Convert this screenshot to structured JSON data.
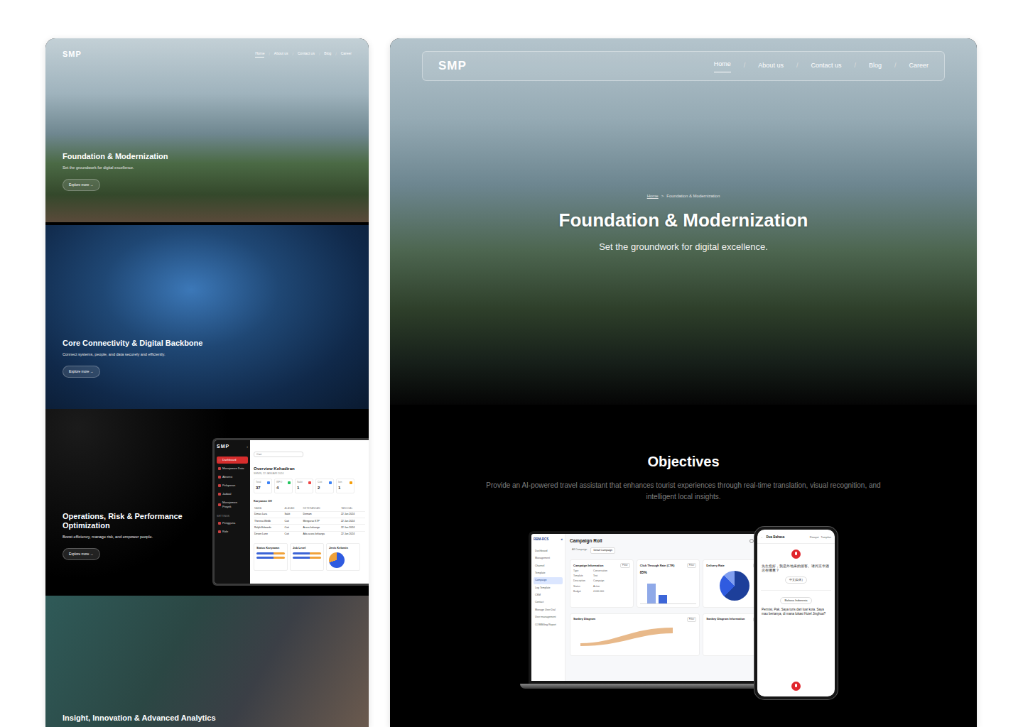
{
  "left_page": {
    "nav": {
      "logo": "SMP",
      "separator": "/",
      "items": [
        {
          "label": "Home",
          "selected": true
        },
        {
          "label": "About us",
          "selected": false
        },
        {
          "label": "Contact us",
          "selected": false
        },
        {
          "label": "Blog",
          "selected": false
        },
        {
          "label": "Career",
          "selected": false
        }
      ]
    },
    "sections": [
      {
        "kind": "photo-city",
        "title": "Foundation & Modernization",
        "subtitle": "Set the groundwork for digital excellence.",
        "cta": "Explore more →"
      },
      {
        "kind": "photo-network",
        "title": "Core Connectivity & Digital Backbone",
        "subtitle": "Connect systems, people, and data securely and efficiently.",
        "cta": "Explore more →"
      },
      {
        "kind": "dashboard",
        "title": "Operations, Risk & Performance Optimization",
        "subtitle": "Boost efficiency, manage risk, and empower people.",
        "cta": "Explore more →"
      },
      {
        "kind": "photo-people",
        "title": "Insight, Innovation & Advanced Analytics"
      }
    ],
    "dashboard": {
      "logo": "SMP",
      "collapse": "‹",
      "search": "Cari",
      "menu": [
        {
          "label": "Dashboard",
          "selected": true
        },
        {
          "label": "Manajemen Data",
          "selected": false
        },
        {
          "label": "Absensi",
          "selected": false
        },
        {
          "label": "Pelaporan",
          "selected": false
        },
        {
          "label": "Jadwal",
          "selected": false
        },
        {
          "label": "Manajemen Proyek",
          "selected": false
        }
      ],
      "settings_label": "SETTINGS",
      "settings": [
        {
          "label": "Pengguna",
          "selected": false
        },
        {
          "label": "Role",
          "selected": false
        }
      ],
      "title": "Overview Kehadiran",
      "date": "SENIN, 22 JANUARI 2024",
      "stats": [
        {
          "label": "Total",
          "value": "37",
          "color": "#3b82f6"
        },
        {
          "label": "WFO",
          "value": "4",
          "color": "#22c55e"
        },
        {
          "label": "Sakit",
          "value": "1",
          "color": "#ef4444"
        },
        {
          "label": "Cuti",
          "value": "2",
          "color": "#3b82f6"
        },
        {
          "label": "Izin",
          "value": "1",
          "color": "#f59e0b"
        }
      ],
      "table_title": "Karyawan Off",
      "table_columns": [
        "NAMA",
        "ALASAN",
        "KETERANGAN",
        "TANGGAL"
      ],
      "table_rows": [
        [
          "Dimas Lara",
          "Sakit",
          "Demam",
          "22 Jan 2024"
        ],
        [
          "Theresa Webb",
          "Cuti",
          "Mengurus KTP",
          "22 Jan 2024"
        ],
        [
          "Ralph Edwards",
          "Cuti",
          "Acara keluarga",
          "22 Jan 2024"
        ],
        [
          "Devon Lane",
          "Cuti",
          "Ada acara keluarga",
          "22 Jan 2024"
        ]
      ],
      "cards": [
        {
          "title": "Status Karyawan"
        },
        {
          "title": "Job Level"
        },
        {
          "title": "Jenis Kelamin",
          "values": [
            70,
            30
          ]
        }
      ]
    }
  },
  "right_page": {
    "nav": {
      "logo": "SMP",
      "separator": "/",
      "items": [
        {
          "label": "Home",
          "selected": true
        },
        {
          "label": "About us",
          "selected": false
        },
        {
          "label": "Contact us",
          "selected": false
        },
        {
          "label": "Blog",
          "selected": false
        },
        {
          "label": "Career",
          "selected": false
        }
      ]
    },
    "breadcrumb": {
      "home": "Home",
      "separator": ">",
      "current": "Foundation & Modernization"
    },
    "title": "Foundation & Modernization",
    "subtitle": "Set the groundwork for digital excellence.",
    "objectives": {
      "title": "Objectives",
      "text": "Provide an AI-powered travel assistant that enhances tourist experiences through real-time translation, visual recognition, and intelligent local insights."
    },
    "laptop": {
      "brand": "RBM-RCS",
      "collapse": "«",
      "title": "Campaign Roll",
      "menu": [
        {
          "label": "Dashboard",
          "selected": false
        },
        {
          "label": "Management",
          "selected": false
        },
        {
          "label": "Channel",
          "selected": false
        },
        {
          "label": "Template",
          "selected": false
        },
        {
          "label": "Campaign",
          "selected": true
        },
        {
          "label": "Log Template",
          "selected": false
        },
        {
          "label": "CSM",
          "selected": false
        },
        {
          "label": "Contact",
          "selected": false
        },
        {
          "label": "Manage User Dial",
          "selected": false
        },
        {
          "label": "User management",
          "selected": false
        },
        {
          "label": "COMBilling Report",
          "selected": false
        }
      ],
      "tabs": [
        {
          "label": "All Campaign",
          "selected": false
        },
        {
          "label": "Detail Campaign",
          "selected": true
        }
      ],
      "filter": "Filter",
      "info_title": "Campaign Information",
      "info_rows": [
        [
          "Type",
          "Conversation"
        ],
        [
          "Template",
          "Test"
        ],
        [
          "Description",
          "Campaign"
        ],
        [
          "Status",
          "Active"
        ],
        [
          "Budget",
          "4.000.000"
        ]
      ],
      "ctr_title": "Click Through Rate (CTR)",
      "ctr_value": "85%",
      "ctr_bars": [
        80,
        35
      ],
      "delivery_title": "Delivery Rate",
      "delivery_values": [
        62,
        25,
        13
      ],
      "sankey_title": "Sankey Diagram",
      "sankey_info_title": "Sankey Diagram Information"
    },
    "phone": {
      "back": "←",
      "title": "Dua Bahasa",
      "history": "Riwayat",
      "display": "Tampilan",
      "translated": "先生您好，我是外地来的游客。请问京华酒店在哪里？",
      "target_lang": "中文(简体)",
      "source_lang": "Bahasa Indonesia",
      "source_text": "Permisi, Pak. Saya turis dari luar kota. Saya mau bertanya, di mana lokasi Hotel Jinghua?"
    }
  }
}
